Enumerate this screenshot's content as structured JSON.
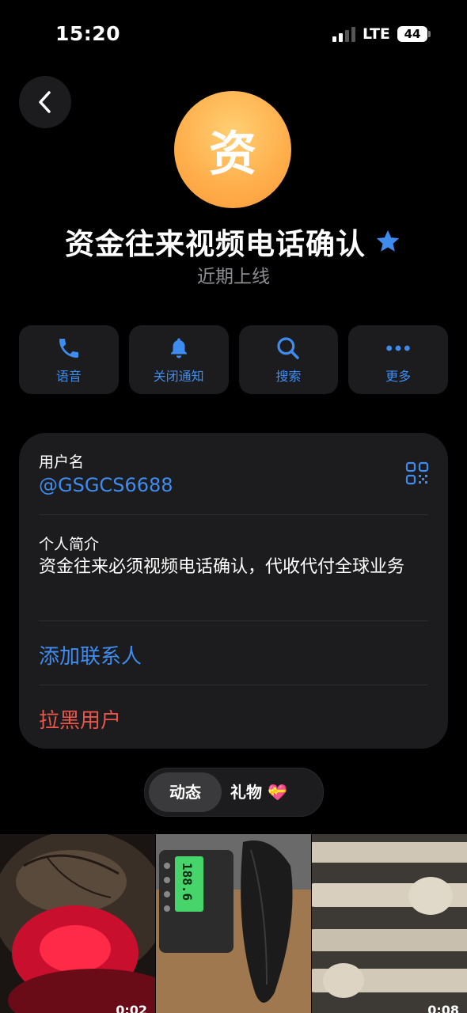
{
  "status_bar": {
    "time": "15:20",
    "network": "LTE",
    "battery": "44"
  },
  "profile": {
    "avatar_letter": "资",
    "name": "资金往来视频电话确认",
    "status": "近期上线",
    "badge_icon": "star-icon"
  },
  "actions": [
    {
      "label": "语音",
      "icon": "phone-icon"
    },
    {
      "label": "关闭通知",
      "icon": "bell-icon"
    },
    {
      "label": "搜索",
      "icon": "search-icon"
    },
    {
      "label": "更多",
      "icon": "more-icon"
    }
  ],
  "info": {
    "username_label": "用户名",
    "username": "@GSGCS6688",
    "bio_label": "个人简介",
    "bio": "资金往来必须视频电话确认，代收代付全球业务",
    "add_contact": "添加联系人",
    "block_user": "拉黑用户"
  },
  "tabs": {
    "active": "动态",
    "gifts": "礼物 💝"
  },
  "media": [
    {
      "duration": "0:02"
    },
    {
      "scale_reading": "188.6",
      "duration": ""
    },
    {
      "duration": "0:08"
    }
  ],
  "colors": {
    "accent": "#3e8cf0",
    "danger": "#e9554a",
    "card": "#1c1c1e",
    "avatar": "#ffad4a"
  }
}
